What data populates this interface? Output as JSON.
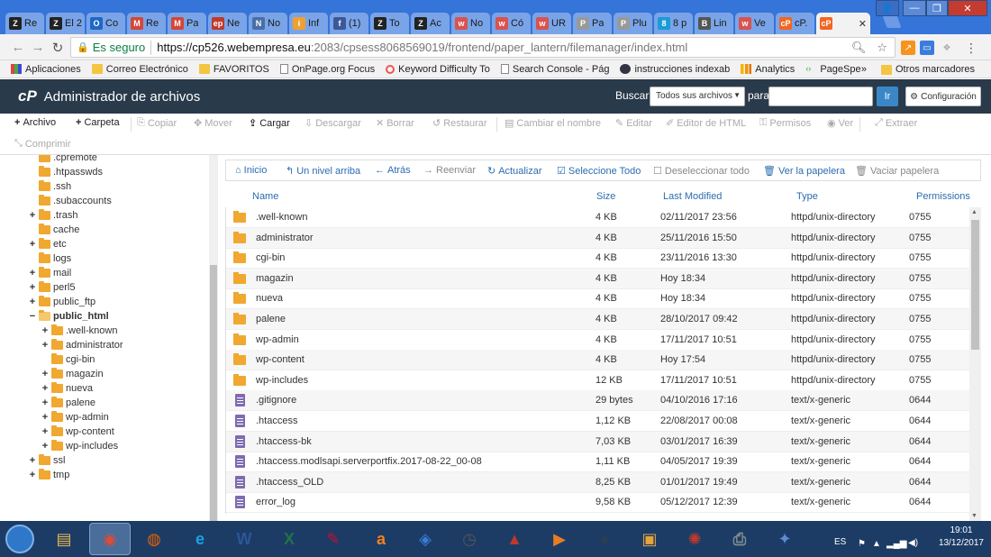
{
  "browser": {
    "tabs": [
      {
        "label": "Re",
        "icon": "Z",
        "color": "#222"
      },
      {
        "label": "El 2",
        "icon": "Z",
        "color": "#222"
      },
      {
        "label": "Co",
        "icon": "O",
        "color": "#1e68c4"
      },
      {
        "label": "Re",
        "icon": "M",
        "color": "#d44638"
      },
      {
        "label": "Pa",
        "icon": "M",
        "color": "#d44638"
      },
      {
        "label": "Ne",
        "icon": "ep",
        "color": "#c0392b"
      },
      {
        "label": "No",
        "icon": "N",
        "color": "#4a6fa5"
      },
      {
        "label": "Inf",
        "icon": "i",
        "color": "#f0a030"
      },
      {
        "label": "(1)",
        "icon": "f",
        "color": "#3b5998"
      },
      {
        "label": "To",
        "icon": "Z",
        "color": "#222"
      },
      {
        "label": "Ac",
        "icon": "Z",
        "color": "#222"
      },
      {
        "label": "No",
        "icon": "w",
        "color": "#d9534f"
      },
      {
        "label": "Có",
        "icon": "w",
        "color": "#d9534f"
      },
      {
        "label": "UR",
        "icon": "w",
        "color": "#d9534f"
      },
      {
        "label": "Pa",
        "icon": "P",
        "color": "#999"
      },
      {
        "label": "Plu",
        "icon": "P",
        "color": "#999"
      },
      {
        "label": "8 p",
        "icon": "8",
        "color": "#1a9bd7"
      },
      {
        "label": "Lin",
        "icon": "B",
        "color": "#555"
      },
      {
        "label": "Ve",
        "icon": "w",
        "color": "#d9534f"
      },
      {
        "label": "cP.",
        "icon": "cP",
        "color": "#f26522"
      },
      {
        "label": "",
        "icon": "cP",
        "color": "#f26522"
      }
    ],
    "window_user_icon": "user-icon",
    "secure_label": "Es seguro",
    "url_host": "https://cp526.webempresa.eu",
    "url_path": ":2083/cpsess8068569019/frontend/paper_lantern/filemanager/index.html",
    "bookmarks": [
      {
        "label": "Aplicaciones",
        "type": "apps"
      },
      {
        "label": "Correo Electrónico",
        "type": "folder"
      },
      {
        "label": "FAVORITOS",
        "type": "folder"
      },
      {
        "label": "OnPage.org Focus",
        "type": "page"
      },
      {
        "label": "Keyword Difficulty To",
        "type": "circle"
      },
      {
        "label": "Search Console - Pág",
        "type": "page"
      },
      {
        "label": "instrucciones indexab",
        "type": "globe"
      },
      {
        "label": "Analytics",
        "type": "bars"
      },
      {
        "label": "PageSpeed Insights",
        "type": "code"
      }
    ],
    "bookmarks_overflow": "»",
    "other_bookmarks": "Otros marcadores"
  },
  "cpanel": {
    "logo": "cP",
    "title": "Administrador de archivos",
    "search_label": "Buscar",
    "search_scope": "Todos sus archivos",
    "para_label": "para",
    "go_label": "Ir",
    "settings_label": "Configuración"
  },
  "toolbar": {
    "row1": [
      {
        "label": "Archivo",
        "icon": "+",
        "on": true
      },
      {
        "label": "Carpeta",
        "icon": "+",
        "on": true
      },
      {
        "label": "Copiar",
        "icon": "⎘",
        "on": false
      },
      {
        "label": "Mover",
        "icon": "✥",
        "on": false
      },
      {
        "label": "Cargar",
        "icon": "⇪",
        "on": true
      },
      {
        "label": "Descargar",
        "icon": "⇩",
        "on": false
      },
      {
        "label": "Borrar",
        "icon": "✕",
        "on": false
      },
      {
        "label": "Restaurar",
        "icon": "↺",
        "on": false
      },
      {
        "label": "Cambiar el nombre",
        "icon": "▤",
        "on": false
      },
      {
        "label": "Editar",
        "icon": "✎",
        "on": false
      },
      {
        "label": "Editor de HTML",
        "icon": "✐",
        "on": false
      },
      {
        "label": "Permisos",
        "icon": "⚿",
        "on": false
      },
      {
        "label": "Ver",
        "icon": "◉",
        "on": false
      },
      {
        "label": "Extraer",
        "icon": "⤢",
        "on": false
      }
    ],
    "row2": [
      {
        "label": "Comprimir",
        "icon": "⤡",
        "on": false
      }
    ]
  },
  "tree": [
    {
      "label": ".cpremote",
      "toggle": "",
      "level": 1
    },
    {
      "label": ".htpasswds",
      "toggle": "",
      "level": 1
    },
    {
      "label": ".ssh",
      "toggle": "",
      "level": 1
    },
    {
      "label": ".subaccounts",
      "toggle": "",
      "level": 1
    },
    {
      "label": ".trash",
      "toggle": "+",
      "level": 1
    },
    {
      "label": "cache",
      "toggle": "",
      "level": 1
    },
    {
      "label": "etc",
      "toggle": "+",
      "level": 1
    },
    {
      "label": "logs",
      "toggle": "",
      "level": 1
    },
    {
      "label": "mail",
      "toggle": "+",
      "level": 1
    },
    {
      "label": "perl5",
      "toggle": "+",
      "level": 1
    },
    {
      "label": "public_ftp",
      "toggle": "+",
      "level": 1
    },
    {
      "label": "public_html",
      "toggle": "−",
      "level": 1,
      "selected": true
    },
    {
      "label": ".well-known",
      "toggle": "+",
      "level": 2
    },
    {
      "label": "administrator",
      "toggle": "+",
      "level": 2
    },
    {
      "label": "cgi-bin",
      "toggle": "",
      "level": 2
    },
    {
      "label": "magazin",
      "toggle": "+",
      "level": 2
    },
    {
      "label": "nueva",
      "toggle": "+",
      "level": 2
    },
    {
      "label": "palene",
      "toggle": "+",
      "level": 2
    },
    {
      "label": "wp-admin",
      "toggle": "+",
      "level": 2
    },
    {
      "label": "wp-content",
      "toggle": "+",
      "level": 2
    },
    {
      "label": "wp-includes",
      "toggle": "+",
      "level": 2
    },
    {
      "label": "ssl",
      "toggle": "+",
      "level": 1
    },
    {
      "label": "tmp",
      "toggle": "+",
      "level": 1
    }
  ],
  "filenav": [
    {
      "label": "Inicio",
      "icon": "⌂",
      "style": "blue"
    },
    {
      "label": "Un nivel arriba",
      "icon": "↰",
      "style": "blue"
    },
    {
      "label": "Atrás",
      "icon": "←",
      "style": "blue"
    },
    {
      "label": "Reenviar",
      "icon": "→",
      "style": "gray"
    },
    {
      "label": "Actualizar",
      "icon": "↻",
      "style": "blue"
    },
    {
      "label": "Seleccione Todo",
      "icon": "☑",
      "style": "blue"
    },
    {
      "label": "Deseleccionar todo",
      "icon": "☐",
      "style": "gray"
    },
    {
      "label": "Ver la papelera",
      "icon": "🗑",
      "style": "blue"
    },
    {
      "label": "Vaciar papelera",
      "icon": "🗑",
      "style": "gray"
    }
  ],
  "columns": {
    "name": "Name",
    "size": "Size",
    "modified": "Last Modified",
    "type": "Type",
    "perms": "Permissions"
  },
  "files": [
    {
      "name": ".well-known",
      "size": "4 KB",
      "modified": "02/11/2017 23:56",
      "type": "httpd/unix-directory",
      "perms": "0755",
      "dir": true
    },
    {
      "name": "administrator",
      "size": "4 KB",
      "modified": "25/11/2016 15:50",
      "type": "httpd/unix-directory",
      "perms": "0755",
      "dir": true
    },
    {
      "name": "cgi-bin",
      "size": "4 KB",
      "modified": "23/11/2016 13:30",
      "type": "httpd/unix-directory",
      "perms": "0755",
      "dir": true
    },
    {
      "name": "magazin",
      "size": "4 KB",
      "modified": "Hoy 18:34",
      "type": "httpd/unix-directory",
      "perms": "0755",
      "dir": true
    },
    {
      "name": "nueva",
      "size": "4 KB",
      "modified": "Hoy 18:34",
      "type": "httpd/unix-directory",
      "perms": "0755",
      "dir": true
    },
    {
      "name": "palene",
      "size": "4 KB",
      "modified": "28/10/2017 09:42",
      "type": "httpd/unix-directory",
      "perms": "0755",
      "dir": true
    },
    {
      "name": "wp-admin",
      "size": "4 KB",
      "modified": "17/11/2017 10:51",
      "type": "httpd/unix-directory",
      "perms": "0755",
      "dir": true
    },
    {
      "name": "wp-content",
      "size": "4 KB",
      "modified": "Hoy 17:54",
      "type": "httpd/unix-directory",
      "perms": "0755",
      "dir": true
    },
    {
      "name": "wp-includes",
      "size": "12 KB",
      "modified": "17/11/2017 10:51",
      "type": "httpd/unix-directory",
      "perms": "0755",
      "dir": true
    },
    {
      "name": ".gitignore",
      "size": "29 bytes",
      "modified": "04/10/2016 17:16",
      "type": "text/x-generic",
      "perms": "0644",
      "dir": false
    },
    {
      "name": ".htaccess",
      "size": "1,12 KB",
      "modified": "22/08/2017 00:08",
      "type": "text/x-generic",
      "perms": "0644",
      "dir": false
    },
    {
      "name": ".htaccess-bk",
      "size": "7,03 KB",
      "modified": "03/01/2017 16:39",
      "type": "text/x-generic",
      "perms": "0644",
      "dir": false
    },
    {
      "name": ".htaccess.modlsapi.serverportfix.2017-08-22_00-08",
      "size": "1,11 KB",
      "modified": "04/05/2017 19:39",
      "type": "text/x-generic",
      "perms": "0644",
      "dir": false
    },
    {
      "name": ".htaccess_OLD",
      "size": "8,25 KB",
      "modified": "01/01/2017 19:49",
      "type": "text/x-generic",
      "perms": "0644",
      "dir": false
    },
    {
      "name": "error_log",
      "size": "9,58 KB",
      "modified": "05/12/2017 12:39",
      "type": "text/x-generic",
      "perms": "0644",
      "dir": false
    }
  ],
  "taskbar": {
    "apps": [
      {
        "name": "explorer",
        "label": "▤",
        "color": "#e8b84a"
      },
      {
        "name": "chrome",
        "label": "◉",
        "color": "#dd4b39",
        "active": true
      },
      {
        "name": "firefox",
        "label": "◍",
        "color": "#e66000"
      },
      {
        "name": "ie",
        "label": "e",
        "color": "#1ba1e2"
      },
      {
        "name": "word",
        "label": "W",
        "color": "#2b579a"
      },
      {
        "name": "excel",
        "label": "X",
        "color": "#217346"
      },
      {
        "name": "app7",
        "label": "✎",
        "color": "#c8102e"
      },
      {
        "name": "avast",
        "label": "a",
        "color": "#f7801e"
      },
      {
        "name": "app9",
        "label": "◈",
        "color": "#3a7bd5"
      },
      {
        "name": "clock",
        "label": "◷",
        "color": "#555"
      },
      {
        "name": "app11",
        "label": "▲",
        "color": "#c0392b"
      },
      {
        "name": "player",
        "label": "▶",
        "color": "#e67e22"
      },
      {
        "name": "app13",
        "label": "●",
        "color": "#2c3e50"
      },
      {
        "name": "app14",
        "label": "▣",
        "color": "#e5a43c"
      },
      {
        "name": "app15",
        "label": "✺",
        "color": "#c0392b"
      },
      {
        "name": "printer",
        "label": "⎙",
        "color": "#7f8c8d"
      },
      {
        "name": "app17",
        "label": "✦",
        "color": "#5d8bd3"
      }
    ],
    "lang": "ES",
    "time": "19:01",
    "date": "13/12/2017"
  }
}
